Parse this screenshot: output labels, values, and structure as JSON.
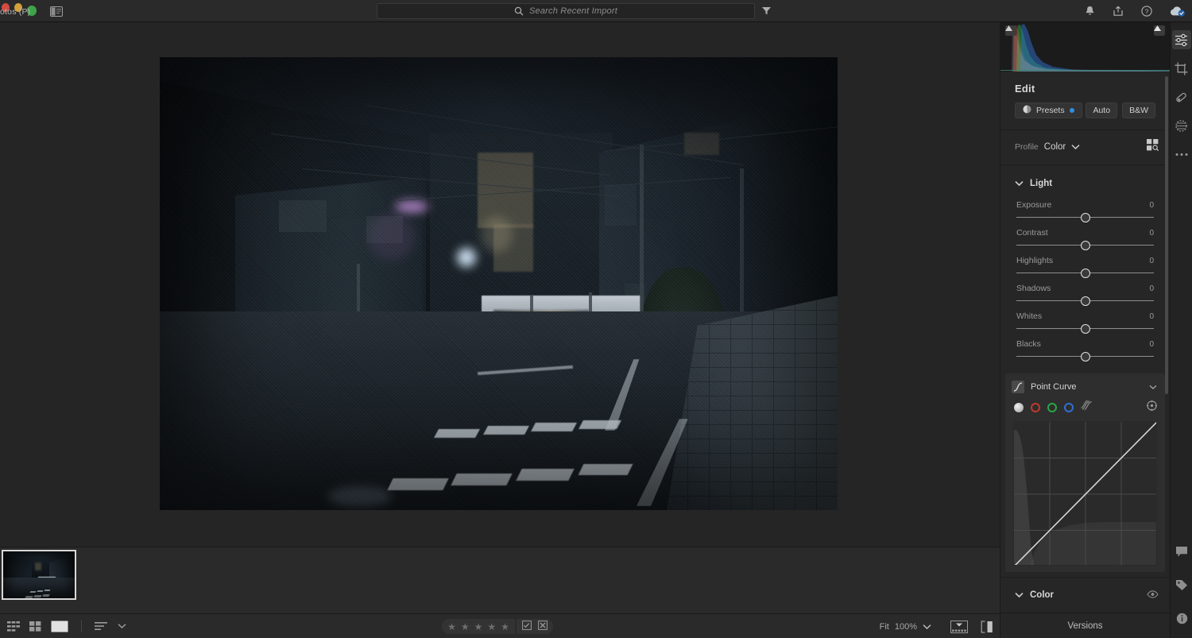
{
  "window": {
    "title": "otos (P)",
    "traffic_lights": [
      "close",
      "minimize",
      "zoom"
    ]
  },
  "topbar": {
    "panel_toggle_icon": "left-panel-toggle-icon",
    "search": {
      "placeholder": "Search Recent Import",
      "value": "",
      "icon": "search-icon"
    },
    "filter_icon": "filter-funnel-icon",
    "right_icons": [
      {
        "name": "notifications-bell-icon",
        "glyph": "bell"
      },
      {
        "name": "share-export-icon",
        "glyph": "share"
      },
      {
        "name": "help-icon",
        "glyph": "question"
      },
      {
        "name": "cloud-sync-icon",
        "glyph": "cloud"
      }
    ]
  },
  "canvas": {
    "photo_alt": "Night street scene with railway crossing and train in Japan"
  },
  "filmstrip": {
    "thumbnails": [
      {
        "name": "filmstrip-thumbnail-1",
        "selected": true
      }
    ]
  },
  "bottombar": {
    "view_icons": [
      {
        "name": "grid-view-icon",
        "label": "Grid"
      },
      {
        "name": "square-grid-view-icon",
        "label": "Compare"
      },
      {
        "name": "detail-view-icon",
        "label": "Detail"
      }
    ],
    "sort_icon": "sort-icon",
    "sort_chevron": "chevron-down-icon",
    "rating": {
      "stars": 5,
      "filled": 0,
      "star_glyph": "★"
    },
    "flags": [
      {
        "name": "flag-pick-icon"
      },
      {
        "name": "flag-reject-icon"
      }
    ],
    "zoom": {
      "fit_label": "Fit",
      "level": "100%",
      "chevron": "chevron-down-icon"
    },
    "right_icons": [
      {
        "name": "filmstrip-toggle-icon"
      },
      {
        "name": "before-after-compare-icon"
      }
    ]
  },
  "editpanel": {
    "histogram": {
      "clip_left_icon": "shadow-clipping-indicator",
      "clip_right_icon": "highlight-clipping-indicator"
    },
    "title": "Edit",
    "presets_button": {
      "label": "Presets",
      "badge": "modified-dot"
    },
    "auto_button": "Auto",
    "bw_button": "B&W",
    "profile": {
      "label": "Profile",
      "value": "Color",
      "chevron": "chevron-down-icon",
      "browse_icon": "profile-browser-icon"
    },
    "light": {
      "title": "Light",
      "collapse_icon": "chevron-down-icon",
      "sliders": [
        {
          "name": "Exposure",
          "value": "0",
          "pos": 50
        },
        {
          "name": "Contrast",
          "value": "0",
          "pos": 50
        },
        {
          "name": "Highlights",
          "value": "0",
          "pos": 50
        },
        {
          "name": "Shadows",
          "value": "0",
          "pos": 50
        },
        {
          "name": "Whites",
          "value": "0",
          "pos": 50
        },
        {
          "name": "Blacks",
          "value": "0",
          "pos": 50
        }
      ]
    },
    "point_curve": {
      "title": "Point Curve",
      "icon": "tone-curve-icon",
      "chevron": "chevron-down-icon",
      "channels": [
        {
          "name": "channel-rgb",
          "color": "#e8e8e8",
          "selected": true
        },
        {
          "name": "channel-red",
          "color": "#c0392b",
          "selected": false
        },
        {
          "name": "channel-green",
          "color": "#27a844",
          "selected": false
        },
        {
          "name": "channel-blue",
          "color": "#2f6fd0",
          "selected": false
        },
        {
          "name": "channel-parametric",
          "color": "#8a8a8a",
          "selected": false
        }
      ],
      "target_icon": "targeted-adjustment-icon"
    },
    "color": {
      "title": "Color",
      "collapse_icon": "chevron-down-icon",
      "visibility_icon": "eye-icon"
    },
    "versions": {
      "label": "Versions"
    }
  },
  "rail": {
    "tools": [
      {
        "name": "edit-tool",
        "icon": "sliders-icon",
        "active": true
      },
      {
        "name": "crop-tool",
        "icon": "crop-icon",
        "active": false
      },
      {
        "name": "healing-tool",
        "icon": "healing-brush-icon",
        "active": false
      },
      {
        "name": "masking-tool",
        "icon": "masking-icon",
        "active": false
      },
      {
        "name": "more-tools",
        "icon": "ellipsis-icon",
        "active": false
      }
    ],
    "bottom_tools": [
      {
        "name": "comments-tool",
        "icon": "comment-bubble-icon"
      },
      {
        "name": "keywords-tool",
        "icon": "tag-icon"
      },
      {
        "name": "info-tool",
        "icon": "info-circle-icon"
      }
    ]
  },
  "theme": {
    "bg": "#1c1c1c",
    "panel": "#262626",
    "accent_blue": "#2d8fe0",
    "text": "#d8d8d8",
    "muted": "#9a9a9a"
  }
}
